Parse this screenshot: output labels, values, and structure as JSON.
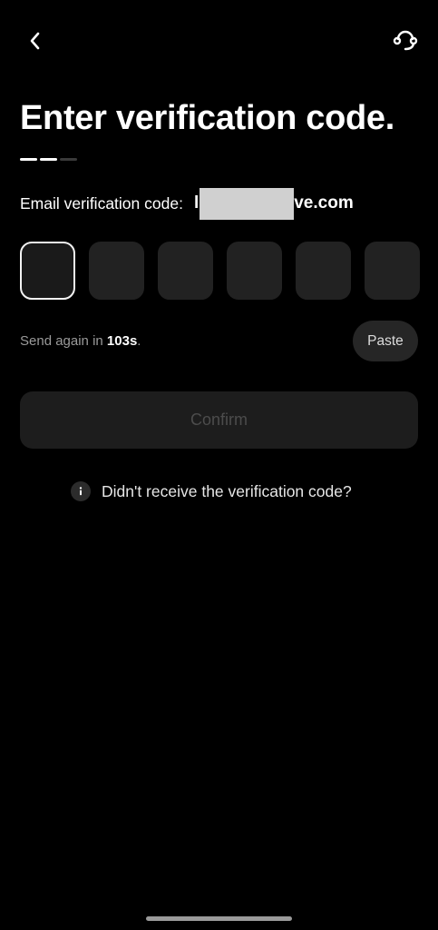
{
  "header": {
    "back_icon": "chevron-left-icon",
    "support_icon": "headset-icon"
  },
  "title": "Enter verification code.",
  "step_progress": {
    "total_steps": 3,
    "completed_steps": 2
  },
  "email": {
    "label": "Email verification code:",
    "visible_prefix": "l",
    "visible_suffix": "ve.com"
  },
  "code_input": {
    "length": 6,
    "active_index": 0,
    "values": [
      "",
      "",
      "",
      "",
      "",
      ""
    ]
  },
  "resend": {
    "prefix": "Send again in",
    "countdown": "103s",
    "suffix": "."
  },
  "paste_label": "Paste",
  "confirm_label": "Confirm",
  "help": {
    "icon": "info-icon",
    "text": "Didn't receive the verification code?"
  },
  "colors": {
    "background": "#000000",
    "box_fill": "#222222",
    "active_border": "#f2f2f2",
    "disabled_text": "#4c4c4c",
    "muted_text": "#9a9a9a"
  }
}
